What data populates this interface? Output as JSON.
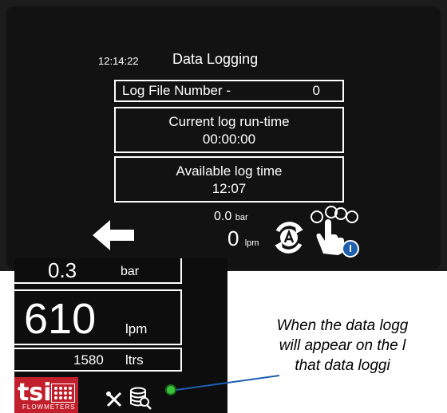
{
  "header": {
    "time": "12:14:22",
    "title": "Data Logging"
  },
  "log_file": {
    "label": "Log File Number -",
    "value": "0"
  },
  "runtime": {
    "label": "Current log run-time",
    "value": "00:00:00"
  },
  "available": {
    "label": "Available log time",
    "value": "12:07"
  },
  "status": {
    "pressure_value": "0.0",
    "pressure_unit": "bar",
    "flow_value": "0",
    "flow_unit": "lpm"
  },
  "info_badge": "I",
  "inset": {
    "pressure_value": "0.3",
    "pressure_unit": "bar",
    "flow_value": "610",
    "flow_unit": "lpm",
    "total_value": "1580",
    "total_unit": "ltrs",
    "logo_text": "tsi",
    "logo_sub": "FLOWMETERS"
  },
  "caption": {
    "line1": "When the data logg",
    "line2": "will appear on the l",
    "line3": "that data loggi"
  },
  "colors": {
    "badge": "#1e5fb0",
    "indicator": "#3bc43b",
    "logo": "#c21f2c",
    "leader": "#1e5fb0"
  },
  "icons": [
    "back-arrow-icon",
    "auto-mode-icon",
    "touch-icon",
    "tools-icon",
    "database-search-icon",
    "logging-indicator-icon"
  ]
}
